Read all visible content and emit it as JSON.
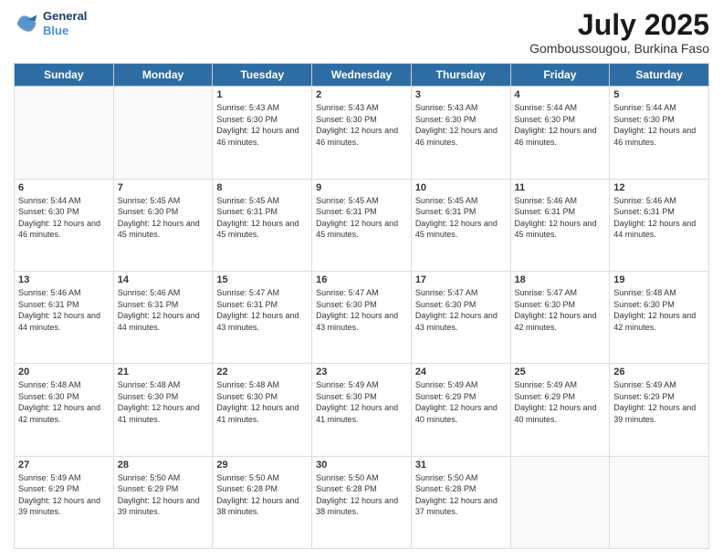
{
  "logo": {
    "line1": "General",
    "line2": "Blue"
  },
  "title": "July 2025",
  "location": "Gomboussougou, Burkina Faso",
  "weekdays": [
    "Sunday",
    "Monday",
    "Tuesday",
    "Wednesday",
    "Thursday",
    "Friday",
    "Saturday"
  ],
  "weeks": [
    [
      {
        "day": "",
        "info": ""
      },
      {
        "day": "",
        "info": ""
      },
      {
        "day": "1",
        "info": "Sunrise: 5:43 AM\nSunset: 6:30 PM\nDaylight: 12 hours and 46 minutes."
      },
      {
        "day": "2",
        "info": "Sunrise: 5:43 AM\nSunset: 6:30 PM\nDaylight: 12 hours and 46 minutes."
      },
      {
        "day": "3",
        "info": "Sunrise: 5:43 AM\nSunset: 6:30 PM\nDaylight: 12 hours and 46 minutes."
      },
      {
        "day": "4",
        "info": "Sunrise: 5:44 AM\nSunset: 6:30 PM\nDaylight: 12 hours and 46 minutes."
      },
      {
        "day": "5",
        "info": "Sunrise: 5:44 AM\nSunset: 6:30 PM\nDaylight: 12 hours and 46 minutes."
      }
    ],
    [
      {
        "day": "6",
        "info": "Sunrise: 5:44 AM\nSunset: 6:30 PM\nDaylight: 12 hours and 46 minutes."
      },
      {
        "day": "7",
        "info": "Sunrise: 5:45 AM\nSunset: 6:30 PM\nDaylight: 12 hours and 45 minutes."
      },
      {
        "day": "8",
        "info": "Sunrise: 5:45 AM\nSunset: 6:31 PM\nDaylight: 12 hours and 45 minutes."
      },
      {
        "day": "9",
        "info": "Sunrise: 5:45 AM\nSunset: 6:31 PM\nDaylight: 12 hours and 45 minutes."
      },
      {
        "day": "10",
        "info": "Sunrise: 5:45 AM\nSunset: 6:31 PM\nDaylight: 12 hours and 45 minutes."
      },
      {
        "day": "11",
        "info": "Sunrise: 5:46 AM\nSunset: 6:31 PM\nDaylight: 12 hours and 45 minutes."
      },
      {
        "day": "12",
        "info": "Sunrise: 5:46 AM\nSunset: 6:31 PM\nDaylight: 12 hours and 44 minutes."
      }
    ],
    [
      {
        "day": "13",
        "info": "Sunrise: 5:46 AM\nSunset: 6:31 PM\nDaylight: 12 hours and 44 minutes."
      },
      {
        "day": "14",
        "info": "Sunrise: 5:46 AM\nSunset: 6:31 PM\nDaylight: 12 hours and 44 minutes."
      },
      {
        "day": "15",
        "info": "Sunrise: 5:47 AM\nSunset: 6:31 PM\nDaylight: 12 hours and 43 minutes."
      },
      {
        "day": "16",
        "info": "Sunrise: 5:47 AM\nSunset: 6:30 PM\nDaylight: 12 hours and 43 minutes."
      },
      {
        "day": "17",
        "info": "Sunrise: 5:47 AM\nSunset: 6:30 PM\nDaylight: 12 hours and 43 minutes."
      },
      {
        "day": "18",
        "info": "Sunrise: 5:47 AM\nSunset: 6:30 PM\nDaylight: 12 hours and 42 minutes."
      },
      {
        "day": "19",
        "info": "Sunrise: 5:48 AM\nSunset: 6:30 PM\nDaylight: 12 hours and 42 minutes."
      }
    ],
    [
      {
        "day": "20",
        "info": "Sunrise: 5:48 AM\nSunset: 6:30 PM\nDaylight: 12 hours and 42 minutes."
      },
      {
        "day": "21",
        "info": "Sunrise: 5:48 AM\nSunset: 6:30 PM\nDaylight: 12 hours and 41 minutes."
      },
      {
        "day": "22",
        "info": "Sunrise: 5:48 AM\nSunset: 6:30 PM\nDaylight: 12 hours and 41 minutes."
      },
      {
        "day": "23",
        "info": "Sunrise: 5:49 AM\nSunset: 6:30 PM\nDaylight: 12 hours and 41 minutes."
      },
      {
        "day": "24",
        "info": "Sunrise: 5:49 AM\nSunset: 6:29 PM\nDaylight: 12 hours and 40 minutes."
      },
      {
        "day": "25",
        "info": "Sunrise: 5:49 AM\nSunset: 6:29 PM\nDaylight: 12 hours and 40 minutes."
      },
      {
        "day": "26",
        "info": "Sunrise: 5:49 AM\nSunset: 6:29 PM\nDaylight: 12 hours and 39 minutes."
      }
    ],
    [
      {
        "day": "27",
        "info": "Sunrise: 5:49 AM\nSunset: 6:29 PM\nDaylight: 12 hours and 39 minutes."
      },
      {
        "day": "28",
        "info": "Sunrise: 5:50 AM\nSunset: 6:29 PM\nDaylight: 12 hours and 39 minutes."
      },
      {
        "day": "29",
        "info": "Sunrise: 5:50 AM\nSunset: 6:28 PM\nDaylight: 12 hours and 38 minutes."
      },
      {
        "day": "30",
        "info": "Sunrise: 5:50 AM\nSunset: 6:28 PM\nDaylight: 12 hours and 38 minutes."
      },
      {
        "day": "31",
        "info": "Sunrise: 5:50 AM\nSunset: 6:28 PM\nDaylight: 12 hours and 37 minutes."
      },
      {
        "day": "",
        "info": ""
      },
      {
        "day": "",
        "info": ""
      }
    ]
  ]
}
